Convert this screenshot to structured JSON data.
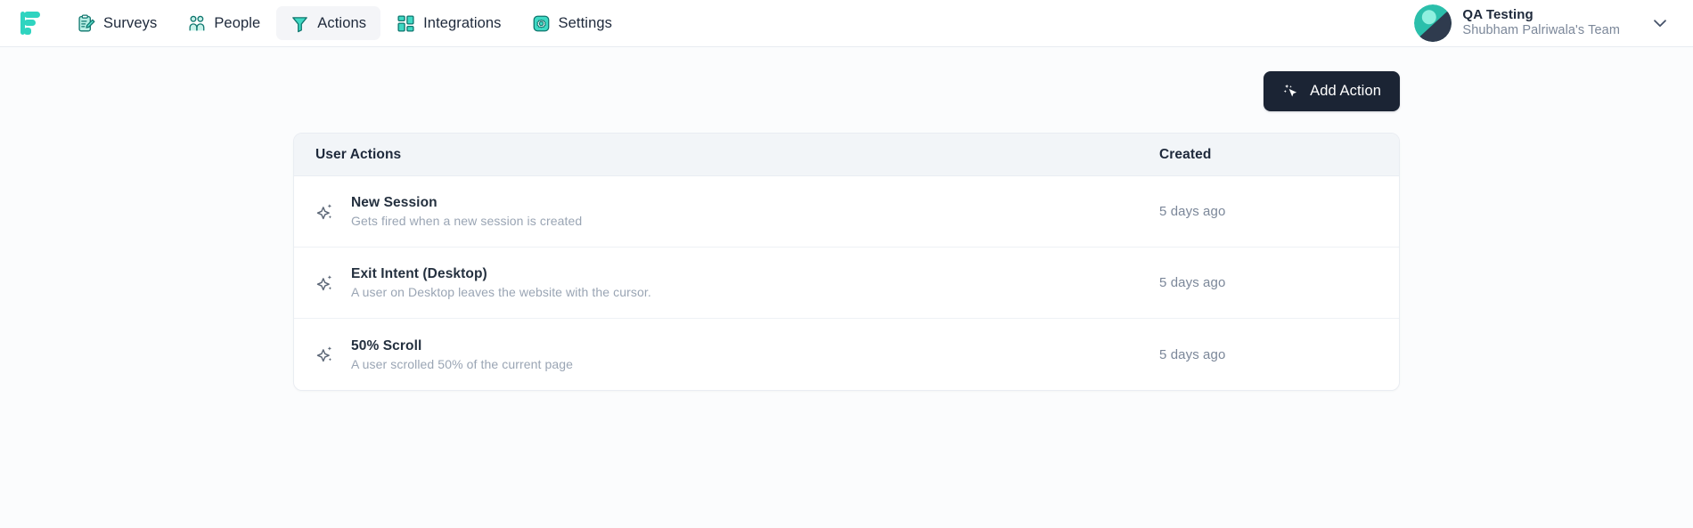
{
  "nav": {
    "logo_name": "formbricks-logo",
    "items": [
      {
        "id": "surveys",
        "label": "Surveys",
        "icon": "clipboard-pencil-icon",
        "active": false
      },
      {
        "id": "people",
        "label": "People",
        "icon": "people-icon",
        "active": false
      },
      {
        "id": "actions",
        "label": "Actions",
        "icon": "funnel-filter-icon",
        "active": true
      },
      {
        "id": "integrations",
        "label": "Integrations",
        "icon": "grid-blocks-icon",
        "active": false
      },
      {
        "id": "settings",
        "label": "Settings",
        "icon": "gear-icon",
        "active": false
      }
    ]
  },
  "org": {
    "name": "QA Testing",
    "team": "Shubham Palriwala's Team",
    "avatar_name": "org-avatar",
    "chevron_icon": "chevron-down-icon"
  },
  "toolbar": {
    "add_action_label": "Add Action",
    "add_action_icon": "mouse-pointer-sparkle-icon"
  },
  "table": {
    "headers": {
      "actions": "User Actions",
      "created": "Created"
    },
    "rows": [
      {
        "icon": "sparkles-icon",
        "title": "New Session",
        "description": "Gets fired when a new session is created",
        "created": "5 days ago"
      },
      {
        "icon": "sparkles-icon",
        "title": "Exit Intent (Desktop)",
        "description": "A user on Desktop leaves the website with the cursor.",
        "created": "5 days ago"
      },
      {
        "icon": "sparkles-icon",
        "title": "50% Scroll",
        "description": "A user scrolled 50% of the current page",
        "created": "5 days ago"
      }
    ]
  },
  "colors": {
    "accent_teal": "#2fd4c0",
    "accent_teal_dark": "#14b8a6",
    "button_dark": "#1b2434",
    "text_primary": "#1e293b",
    "text_muted": "#9aa5b4",
    "page_bg": "#fbfcfd",
    "header_bg": "#f2f5f8"
  }
}
